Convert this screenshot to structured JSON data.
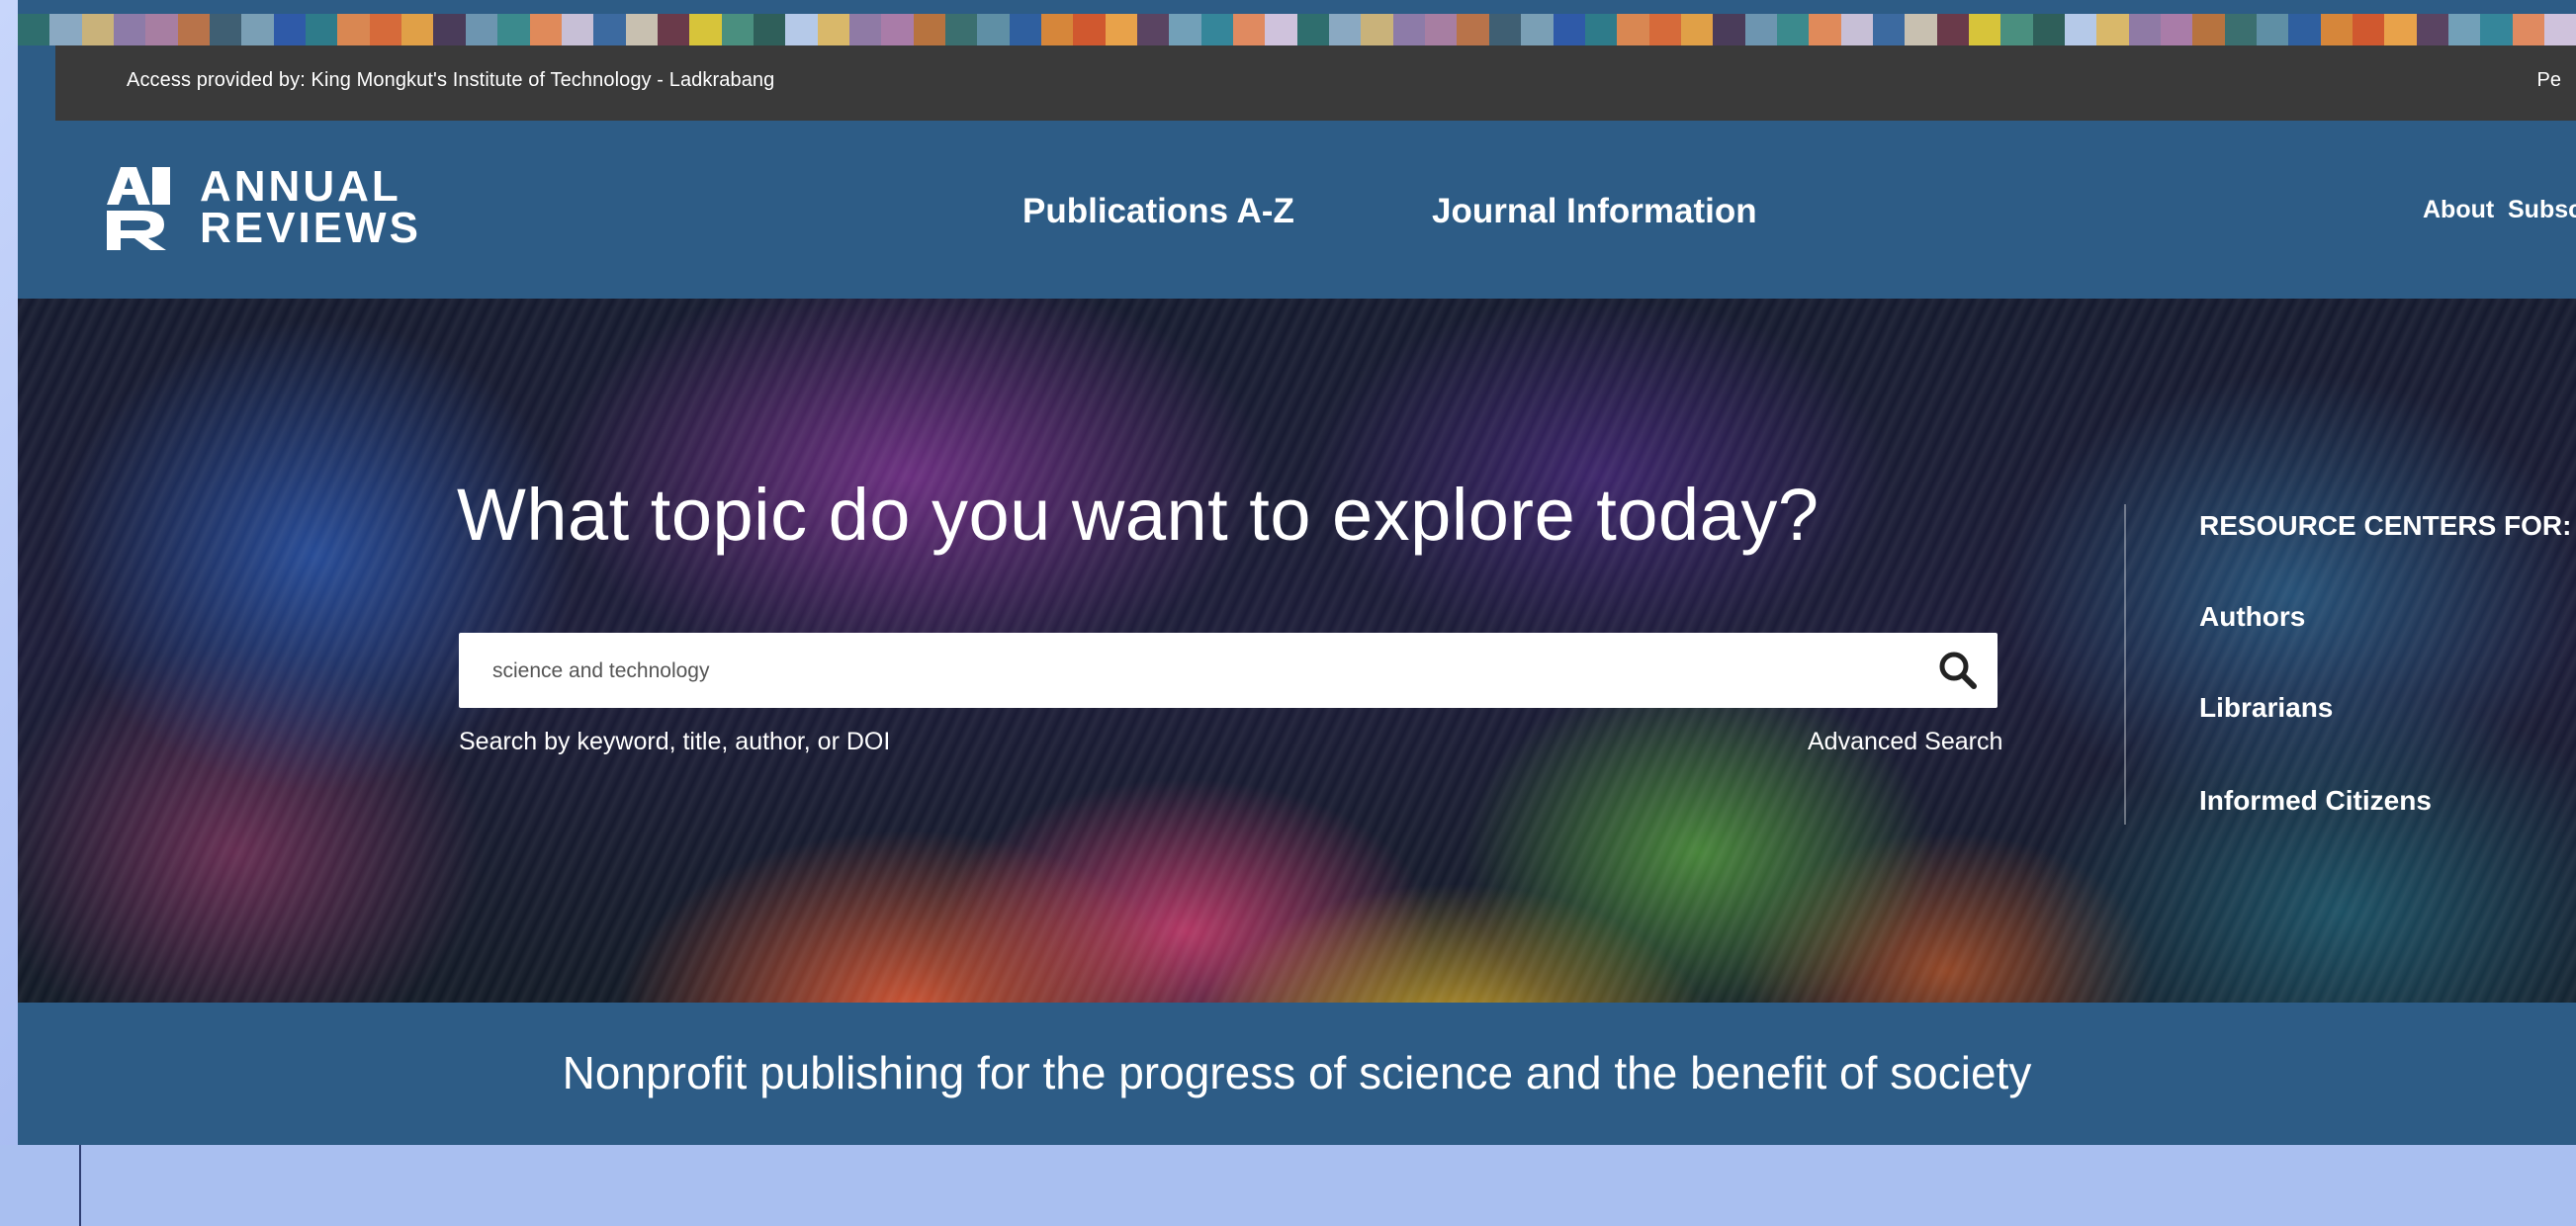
{
  "access_bar": {
    "text": "Access provided by: King Mongkut's Institute of Technology - Ladkrabang",
    "right_text": "Pe"
  },
  "header": {
    "logo": {
      "line1": "ANNUAL",
      "line2": "REVIEWS",
      "mark": "AR"
    },
    "nav": [
      {
        "label": "Publications A-Z"
      },
      {
        "label": "Journal Information"
      }
    ],
    "right_links": [
      {
        "label": "About"
      },
      {
        "label": "Subscri"
      }
    ]
  },
  "hero": {
    "title": "What topic do you want to explore today?",
    "search": {
      "value": "science and technology",
      "placeholder": "",
      "hint": "Search by keyword, title, author, or DOI",
      "advanced_label": "Advanced Search"
    },
    "resource_centers": {
      "heading": "RESOURCE CENTERS FOR:",
      "items": [
        {
          "label": "Authors"
        },
        {
          "label": "Librarians"
        },
        {
          "label": "Informed Citizens"
        }
      ]
    }
  },
  "tagline": "Nonprofit publishing for the progress of science and the benefit of society",
  "colors": {
    "brand_blue": "#2d5c86",
    "access_bar_bg": "#3a3a3a",
    "stripe": [
      "#2f6e6e",
      "#8aa9c2",
      "#c9b27a",
      "#8d7ba8",
      "#a77ea2",
      "#b8734a",
      "#3f5f73",
      "#7a9fb5",
      "#2f5aa8",
      "#2e7b8a",
      "#d98752",
      "#d66a3a",
      "#e0a047",
      "#4a3c5a",
      "#6d95b0",
      "#3b8a8d",
      "#e08a5a",
      "#c7bfd6",
      "#3c6aa0",
      "#c8c0b0",
      "#6a3a4a",
      "#d7c43a",
      "#4a8f7f",
      "#2f5f5a",
      "#b5c9e8",
      "#d9b86a",
      "#8f7aa5",
      "#a97ca8",
      "#b7733f",
      "#3b6f6f",
      "#5f8fa5",
      "#2f5f9f",
      "#d6863a",
      "#d0582f",
      "#e8a24a",
      "#5a4462",
      "#72a0b8",
      "#35869a",
      "#e08a60",
      "#cfc2dc"
    ]
  }
}
